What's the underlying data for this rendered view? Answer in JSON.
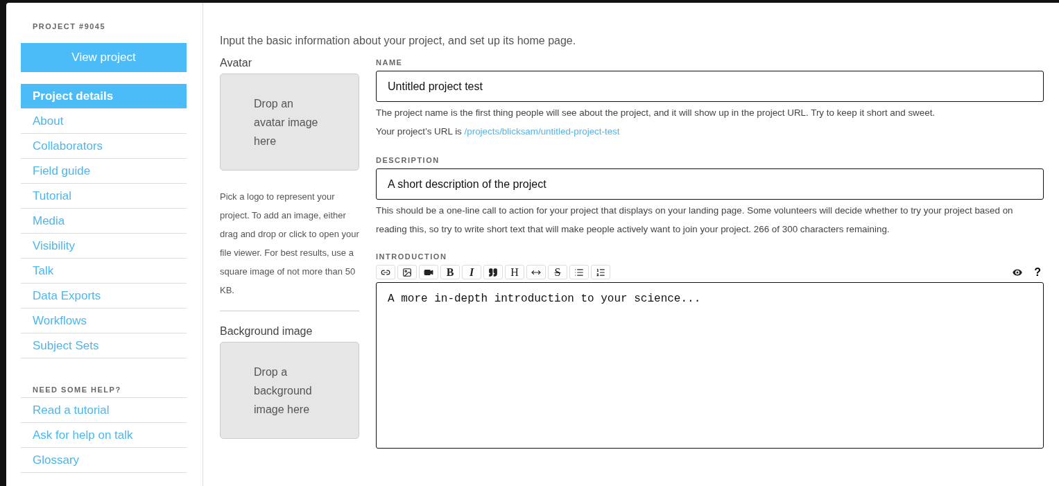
{
  "sidebar": {
    "project_label": "PROJECT #9045",
    "view_button": "View project",
    "items": [
      {
        "label": "Project details",
        "selected": true
      },
      {
        "label": "About",
        "selected": false
      },
      {
        "label": "Collaborators",
        "selected": false
      },
      {
        "label": "Field guide",
        "selected": false
      },
      {
        "label": "Tutorial",
        "selected": false
      },
      {
        "label": "Media",
        "selected": false
      },
      {
        "label": "Visibility",
        "selected": false
      },
      {
        "label": "Talk",
        "selected": false
      },
      {
        "label": "Data Exports",
        "selected": false
      },
      {
        "label": "Workflows",
        "selected": false
      },
      {
        "label": "Subject Sets",
        "selected": false
      }
    ],
    "help_heading": "NEED SOME HELP?",
    "help_links": [
      "Read a tutorial",
      "Ask for help on talk",
      "Glossary"
    ]
  },
  "intro": "Input the basic information about your project, and set up its home page.",
  "avatar": {
    "label": "Avatar",
    "drop_text": "Drop an avatar image here",
    "help": "Pick a logo to represent your project. To add an image, either drag and drop or click to open your file viewer. For best results, use a square image of not more than 50 KB."
  },
  "background": {
    "label": "Background image",
    "drop_text": "Drop a background image here"
  },
  "name": {
    "label": "NAME",
    "value": "Untitled project test",
    "hint": "The project name is the first thing people will see about the project, and it will show up in the project URL. Try to keep it short and sweet.",
    "url_prefix": "Your project’s URL is ",
    "url_link": "/projects/blicksam/untitled-project-test"
  },
  "description": {
    "label": "DESCRIPTION",
    "value": "A short description of the project",
    "hint": "This should be a one-line call to action for your project that displays on your landing page. Some volunteers will decide whether to try your project based on reading this, so try to write short text that will make people actively want to join your project. 266 of 300 characters remaining."
  },
  "introduction": {
    "label": "INTRODUCTION",
    "placeholder": "A more in-depth introduction to your science...",
    "toolbar": [
      {
        "kind": "link"
      },
      {
        "kind": "image"
      },
      {
        "kind": "video"
      },
      {
        "kind": "bold",
        "label": "B"
      },
      {
        "kind": "italic",
        "label": "I"
      },
      {
        "kind": "quote"
      },
      {
        "kind": "heading",
        "label": "H"
      },
      {
        "kind": "rule"
      },
      {
        "kind": "strike",
        "label": "S"
      },
      {
        "kind": "bullets"
      },
      {
        "kind": "numbers"
      }
    ],
    "help_label": "?"
  }
}
